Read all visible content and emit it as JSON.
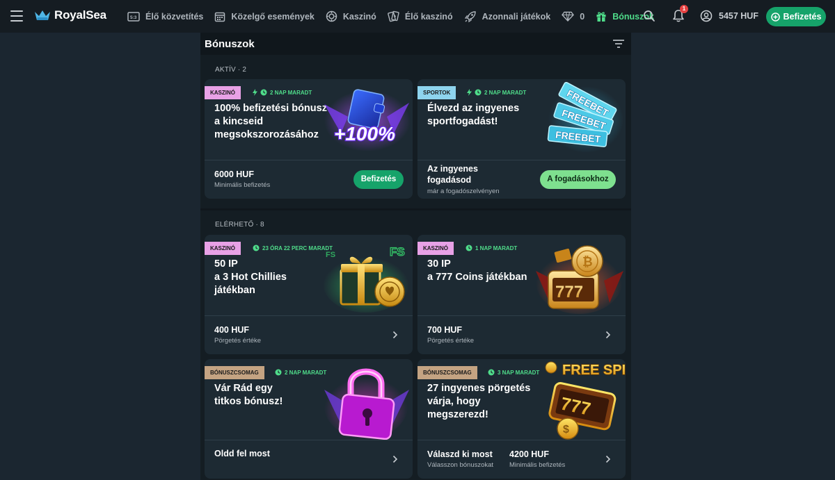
{
  "header": {
    "logo_text": "RoyalSea",
    "nav": [
      {
        "label": "Élő közvetítés",
        "icon": "live-tv-icon"
      },
      {
        "label": "Közelgő események",
        "icon": "calendar-icon"
      },
      {
        "label": "Kaszinó",
        "icon": "casino-chip-icon"
      },
      {
        "label": "Élő kaszinó",
        "icon": "cards-icon"
      },
      {
        "label": "Azonnali játékok",
        "icon": "rocket-icon"
      },
      {
        "label": "0",
        "icon": "diamond-icon"
      },
      {
        "label": "Bónuszok",
        "icon": "gift-icon",
        "active": true
      }
    ],
    "notification_count": "1",
    "balance": "5457 HUF",
    "deposit_label": "Befizetés"
  },
  "panel": {
    "title": "Bónuszok",
    "active_label": "AKTÍV · 2",
    "available_label": "ELÉRHETŐ · 8"
  },
  "active_cards": [
    {
      "tag": "KASZINÓ",
      "timer": "2 NAP MARADT",
      "title": "100% befizetési bónusz\na kincseid\nmegsokszorozásához",
      "art_text": "+100%",
      "amount": "6000 HUF",
      "sub": "Minimális befizetés",
      "button": "Befizetés"
    },
    {
      "tag": "SPORTOK",
      "timer": "2 NAP MARADT",
      "title": "Élvezd az ingyenes\nsportfogadást!",
      "art_text": "FREEBET",
      "amount": "Az ingyenes\nfogadásod",
      "sub": "már a fogadószelvényen",
      "button": "A fogadásokhoz"
    }
  ],
  "available_cards": [
    {
      "tag": "KASZINÓ",
      "timer": "23 ÓRA 22 PERC MARADT",
      "title": "50 IP\na 3 Hot Chillies\njátékban",
      "art_text": "FS",
      "amount": "400 HUF",
      "sub": "Pörgetés értéke"
    },
    {
      "tag": "KASZINÓ",
      "timer": "1 NAP MARADT",
      "title": "30 IP\na 777 Coins játékban",
      "art_text": "777",
      "amount": "700 HUF",
      "sub": "Pörgetés értéke"
    },
    {
      "tag": "BÓNUSZCSOMAG",
      "timer": "2 NAP MARADT",
      "title": "Vár Rád egy\ntitkos bónusz!",
      "amount": "Oldd fel most",
      "sub": ""
    },
    {
      "tag": "BÓNUSZCSOMAG",
      "timer": "3 NAP MARADT",
      "title": "27 ingyenes pörgetés\nvárja, hogy\nmegszerezd!",
      "art_text": "FREE SPINS",
      "amount": "Válaszd ki most",
      "sub": "Válasszon bónuszokat",
      "amount2": "4200 HUF",
      "sub2": "Minimális befizetés"
    }
  ],
  "colors": {
    "accent_green": "#4fdc8a",
    "button_green": "#16a36a",
    "tag_casino": "#e8a1e6",
    "tag_sport": "#8ed4ee",
    "tag_package": "#c4a382"
  }
}
